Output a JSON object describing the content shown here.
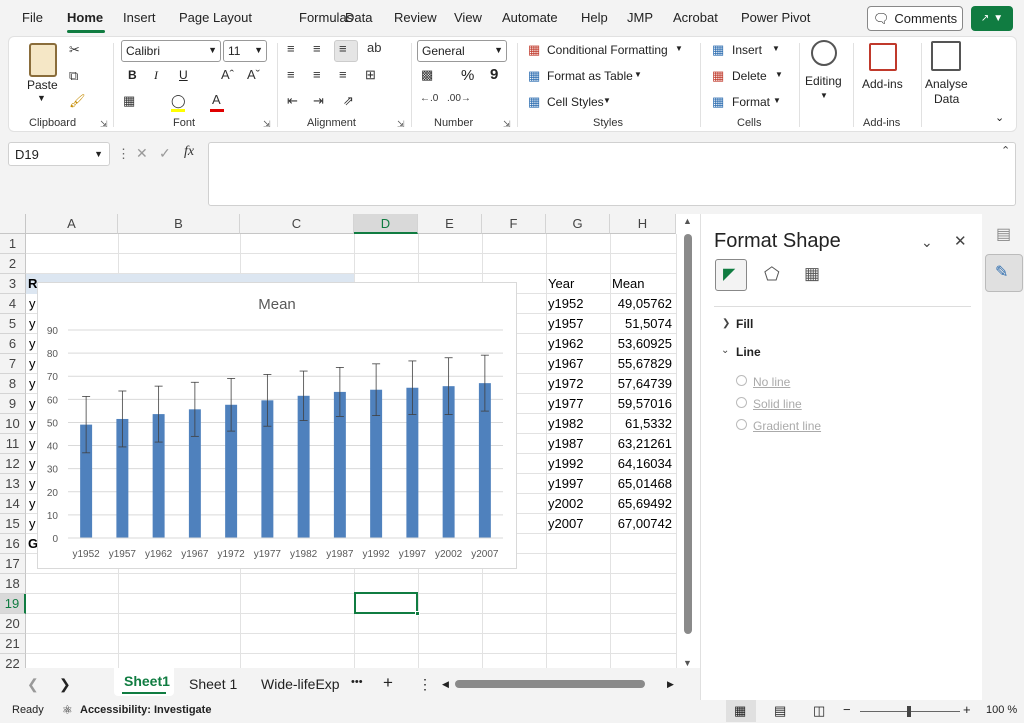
{
  "menu": {
    "items": [
      "File",
      "Home",
      "Insert",
      "Page Layout",
      "Formulas",
      "Data",
      "Review",
      "View",
      "Automate",
      "Help",
      "JMP",
      "Acrobat",
      "Power Pivot"
    ],
    "active": "Home",
    "comments": "Comments"
  },
  "ribbon": {
    "clipboard": {
      "paste": "Paste",
      "label": "Clipboard"
    },
    "font": {
      "name": "Calibri",
      "size": "11",
      "label": "Font",
      "bold": "B",
      "italic": "I",
      "underline": "U"
    },
    "alignment": {
      "label": "Alignment"
    },
    "number": {
      "format": "General",
      "label": "Number",
      "percent": "%",
      "comma": "9"
    },
    "styles": {
      "conditional": "Conditional Formatting",
      "table": "Format as Table",
      "cell": "Cell Styles",
      "label": "Styles"
    },
    "cells": {
      "insert": "Insert",
      "delete": "Delete",
      "format": "Format",
      "label": "Cells"
    },
    "editing": {
      "label": "Editing"
    },
    "addins": {
      "button": "Add-ins",
      "label": "Add-ins"
    },
    "analyse": {
      "line1": "Analyse",
      "line2": "Data"
    }
  },
  "formula_bar": {
    "name_box": "D19",
    "fx": "fx",
    "content": ""
  },
  "sheet": {
    "columns": [
      "A",
      "B",
      "C",
      "D",
      "E",
      "F",
      "G",
      "H"
    ],
    "rows": [
      "1",
      "2",
      "3",
      "4",
      "5",
      "6",
      "7",
      "8",
      "9",
      "10",
      "11",
      "12",
      "13",
      "14",
      "15",
      "16",
      "17",
      "18",
      "19",
      "20",
      "21",
      "22"
    ],
    "selected_cell": "D19",
    "header_g": "Year",
    "header_h": "Mean",
    "years": [
      "y1952",
      "y1957",
      "y1962",
      "y1967",
      "y1972",
      "y1977",
      "y1982",
      "y1987",
      "y1992",
      "y1997",
      "y2002",
      "y2007"
    ],
    "means": [
      "49,05762",
      "51,5074",
      "53,60925",
      "55,67829",
      "57,64739",
      "59,57016",
      "61,5332",
      "63,21261",
      "64,16034",
      "65,01468",
      "65,69492",
      "67,00742"
    ],
    "col_a_fragment": "y",
    "a3_fragment": "R",
    "a16_fragment": "G"
  },
  "chart_data": {
    "type": "bar",
    "title": "Mean",
    "categories": [
      "y1952",
      "y1957",
      "y1962",
      "y1967",
      "y1972",
      "y1977",
      "y1982",
      "y1987",
      "y1992",
      "y1997",
      "y2002",
      "y2007"
    ],
    "values": [
      49.05762,
      51.5074,
      53.60925,
      55.67829,
      57.64739,
      59.57016,
      61.5332,
      63.21261,
      64.16034,
      65.01468,
      65.69492,
      67.00742
    ],
    "error_plus_minus": [
      12.2,
      12.1,
      12.1,
      11.7,
      11.4,
      11.2,
      10.7,
      10.6,
      11.2,
      11.6,
      12.3,
      12.1
    ],
    "ylim": [
      0,
      90
    ],
    "yticks": [
      "0",
      "10",
      "20",
      "30",
      "40",
      "50",
      "60",
      "70",
      "80",
      "90"
    ],
    "grid": true,
    "bar_color": "#4f81bd"
  },
  "sheet_tabs": {
    "tabs": [
      "Sheet1",
      "Sheet 1",
      "Wide-lifeExp"
    ],
    "active": "Sheet1",
    "more": "•••",
    "add": "+"
  },
  "status": {
    "ready": "Ready",
    "accessibility": "Accessibility: Investigate",
    "zoom": "100 %"
  },
  "format_pane": {
    "title": "Format Shape",
    "fill": "Fill",
    "line": "Line",
    "no_line": "No line",
    "solid_line": "Solid line",
    "gradient_line": "Gradient line"
  },
  "accent": "#107c41"
}
